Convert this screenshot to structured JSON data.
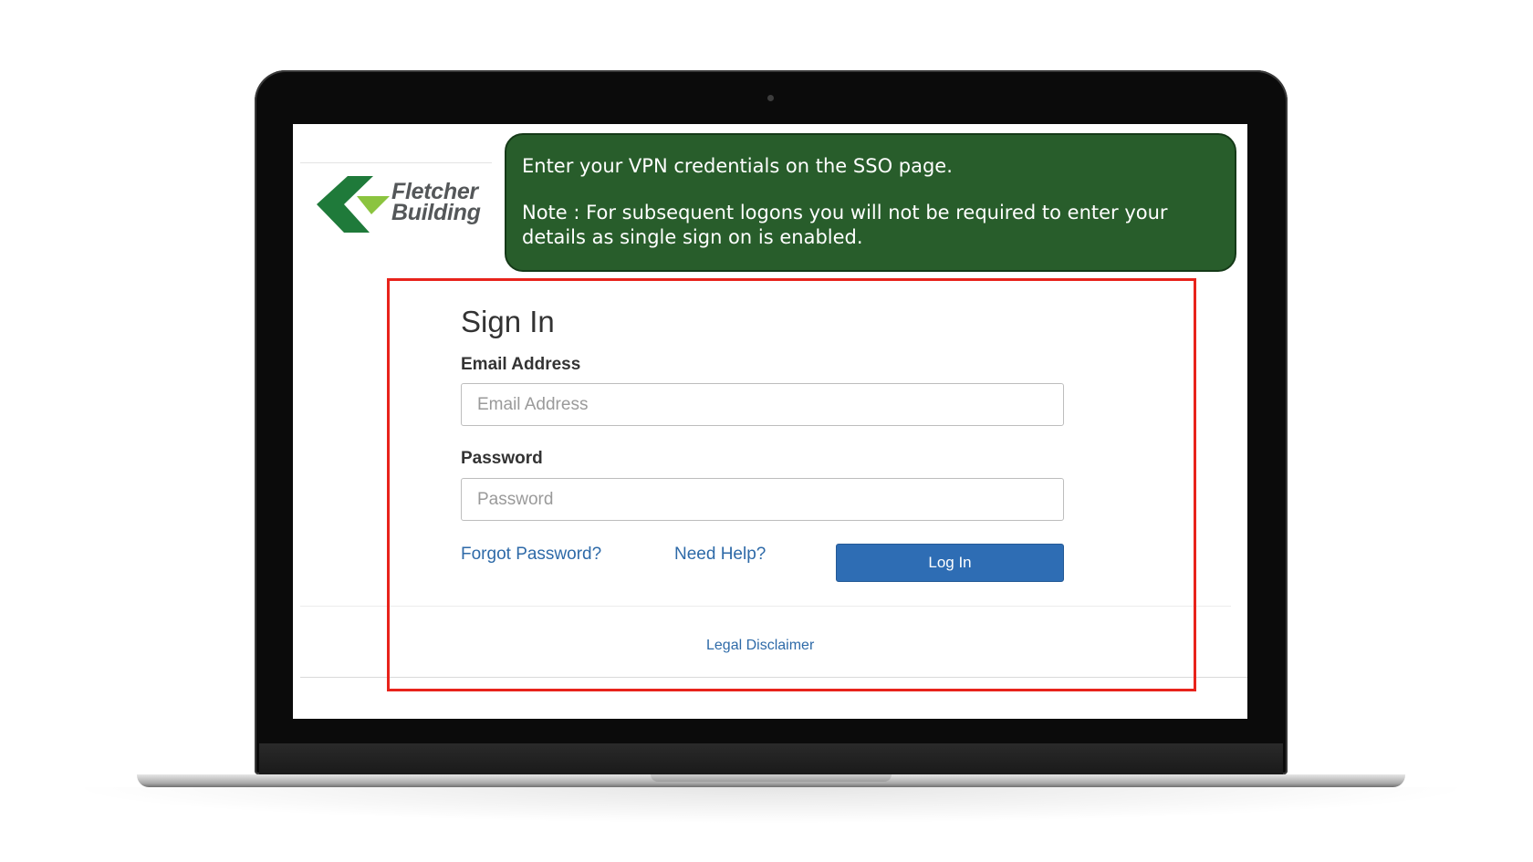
{
  "brand": {
    "logo_line1": "Fletcher",
    "logo_line2": "Building",
    "logo_green_dark": "#1f7a3a",
    "logo_green_light": "#8bc43f"
  },
  "callout": {
    "line1": "Enter your VPN credentials on the SSO page.",
    "note": "Note : For subsequent logons you will not be required to enter your details as single sign on is enabled.",
    "background": "#285d2b"
  },
  "highlight_color": "#e8231b",
  "signin": {
    "title": "Sign In",
    "email_label": "Email Address",
    "email_placeholder": "Email Address",
    "password_label": "Password",
    "password_placeholder": "Password",
    "forgot_password": "Forgot Password?",
    "need_help": "Need Help?",
    "login_button": "Log In",
    "legal_disclaimer": "Legal Disclaimer",
    "button_color": "#2e6db4",
    "link_color": "#2e6aa8"
  }
}
